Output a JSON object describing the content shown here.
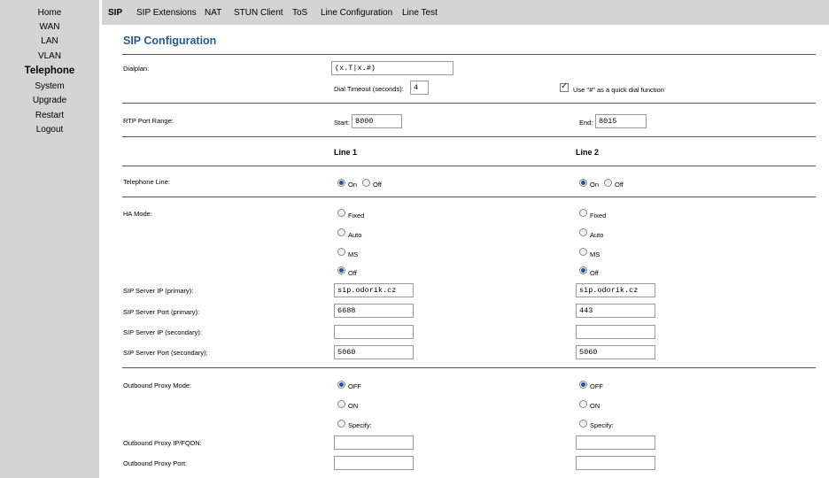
{
  "sidebar": {
    "items": [
      {
        "label": "Home"
      },
      {
        "label": "WAN"
      },
      {
        "label": "LAN"
      },
      {
        "label": "VLAN"
      },
      {
        "label": "Telephone"
      },
      {
        "label": "System"
      },
      {
        "label": "Upgrade"
      },
      {
        "label": "Restart"
      },
      {
        "label": "Logout"
      }
    ],
    "active": "Telephone"
  },
  "tabs": [
    {
      "label": "SIP"
    },
    {
      "label": "SIP Extensions"
    },
    {
      "label": "NAT"
    },
    {
      "label": "STUN Client"
    },
    {
      "label": "ToS"
    },
    {
      "label": "Line Configuration"
    },
    {
      "label": "Line Test"
    }
  ],
  "active_tab": "SIP",
  "page": {
    "title": "SIP Configuration"
  },
  "dialplan": {
    "label": "Dialplan:",
    "value": "(x.T|x.#)",
    "timeout_label": "Dial Timeout (seconds):",
    "timeout_value": "4",
    "quick_dial_label": "Use \"#\" as a quick dial function",
    "quick_dial_checked": true
  },
  "rtp": {
    "label": "RTP Port Range:",
    "start_label": "Start:",
    "start_value": "8000",
    "end_label": "End:",
    "end_value": "8015"
  },
  "columns": {
    "line1": "Line 1",
    "line2": "Line 2"
  },
  "labels": {
    "telephone_line": "Telephone Line:",
    "ha_mode": "HA Mode:",
    "sip_ip_primary": "SIP Server IP (primary):",
    "sip_port_primary": "SIP Server Port (primary):",
    "sip_ip_secondary": "SIP Server IP (secondary):",
    "sip_port_secondary": "SIP Server Port (secondary):",
    "outbound_mode": "Outbound Proxy Mode:",
    "outbound_ip": "Outbound Proxy IP/FQDN:",
    "outbound_port": "Outbound Proxy Port:"
  },
  "options": {
    "on": "On",
    "off": "Off",
    "fixed": "Fixed",
    "auto": "Auto",
    "ms": "MS",
    "proxy_off": "OFF",
    "proxy_on": "ON",
    "specify": "Specify:"
  },
  "line1": {
    "telephone": "On",
    "ha_mode": "Off",
    "sip_ip_primary": "sip.odorik.cz",
    "sip_port_primary": "6688",
    "sip_ip_secondary": "",
    "sip_port_secondary": "5060",
    "outbound_mode": "OFF",
    "outbound_ip": "",
    "outbound_port": ""
  },
  "line2": {
    "telephone": "On",
    "ha_mode": "Off",
    "sip_ip_primary": "sip.odorik.cz",
    "sip_port_primary": "443",
    "sip_ip_secondary": "",
    "sip_port_secondary": "5060",
    "outbound_mode": "OFF",
    "outbound_ip": "",
    "outbound_port": ""
  }
}
